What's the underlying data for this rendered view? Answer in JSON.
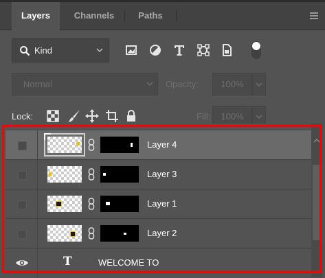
{
  "tabs": [
    {
      "label": "Layers",
      "active": true
    },
    {
      "label": "Channels",
      "active": false
    },
    {
      "label": "Paths",
      "active": false
    }
  ],
  "filter": {
    "kind_label": "Kind",
    "icons": [
      "image-filter-icon",
      "adjustment-filter-icon",
      "type-filter-icon",
      "shape-filter-icon",
      "smart-object-filter-icon",
      "filter-toggle-icon"
    ]
  },
  "blend": {
    "mode": "Normal",
    "opacity_label": "Opacity:",
    "opacity_value": "100%"
  },
  "lock": {
    "label": "Lock:",
    "icons": [
      "lock-transparent-pixels-icon",
      "lock-image-pixels-icon",
      "lock-position-icon",
      "lock-artboard-icon",
      "lock-all-icon"
    ],
    "fill_label": "Fill:",
    "fill_value": "100%"
  },
  "layers": [
    {
      "name": "Layer 4",
      "selected": true,
      "visible": false,
      "type": "pixel"
    },
    {
      "name": "Layer 3",
      "selected": false,
      "visible": false,
      "type": "pixel"
    },
    {
      "name": "Layer 1",
      "selected": false,
      "visible": false,
      "type": "pixel"
    },
    {
      "name": "Layer 2",
      "selected": false,
      "visible": false,
      "type": "pixel"
    },
    {
      "name": "WELCOME TO",
      "selected": false,
      "visible": true,
      "type": "text",
      "type_glyph": "T"
    }
  ],
  "colors": {
    "panel_bg": "#535353",
    "tab_bar_bg": "#424242",
    "selected_row": "#6a6a6a",
    "highlight": "#ff0000",
    "accent_yellow": "#f2c200"
  }
}
